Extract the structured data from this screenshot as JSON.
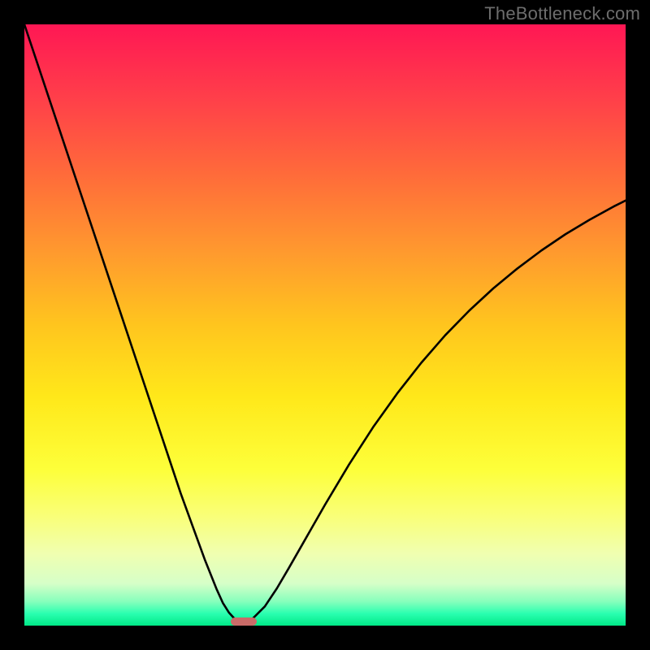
{
  "watermark": "TheBottleneck.com",
  "colors": {
    "curve": "#000000",
    "marker": "#c96b68",
    "frame": "#000000"
  },
  "chart_data": {
    "type": "line",
    "title": "",
    "xlabel": "",
    "ylabel": "",
    "xlim": [
      0,
      100
    ],
    "ylim": [
      0,
      100
    ],
    "legend": false,
    "grid": false,
    "annotations": [],
    "series": [
      {
        "name": "bottleneck-curve",
        "x": [
          0,
          2,
          4,
          6,
          8,
          10,
          12,
          14,
          16,
          18,
          20,
          22,
          24,
          26,
          28,
          30,
          32,
          33,
          34,
          35,
          36,
          37,
          38,
          40,
          42,
          44,
          46,
          48,
          50,
          54,
          58,
          62,
          66,
          70,
          74,
          78,
          82,
          86,
          90,
          94,
          98,
          100
        ],
        "y": [
          100,
          94,
          88,
          82,
          76,
          70,
          64,
          58,
          52,
          46,
          40,
          34,
          28,
          22,
          16.5,
          11,
          6,
          3.8,
          2.2,
          1.1,
          0.55,
          0.55,
          1.2,
          3.2,
          6.2,
          9.6,
          13.1,
          16.6,
          20.1,
          26.8,
          33,
          38.6,
          43.7,
          48.3,
          52.4,
          56.1,
          59.4,
          62.4,
          65.1,
          67.5,
          69.7,
          70.7
        ]
      }
    ],
    "minimum_marker": {
      "x_center": 36.5,
      "width_pct": 4.3,
      "y": 0.55,
      "height_pct": 1.4
    }
  }
}
